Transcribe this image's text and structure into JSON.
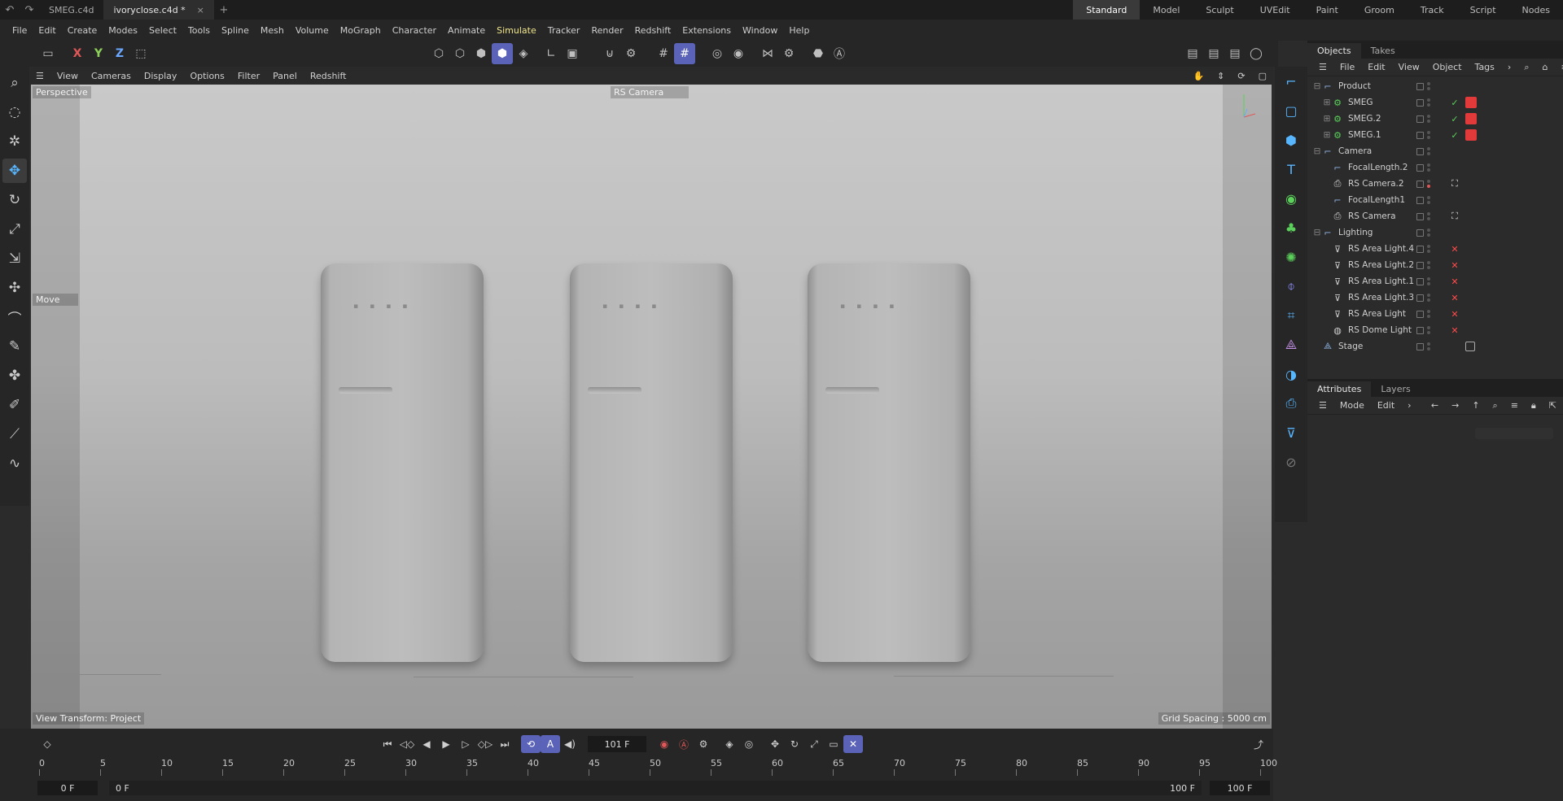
{
  "tabs": [
    {
      "label": "SMEG.c4d",
      "active": false
    },
    {
      "label": "ivoryclose.c4d *",
      "active": true
    }
  ],
  "layouts": [
    "Standard",
    "Model",
    "Sculpt",
    "UVEdit",
    "Paint",
    "Groom",
    "Track",
    "Script",
    "Nodes"
  ],
  "menu": [
    "File",
    "Edit",
    "Create",
    "Modes",
    "Select",
    "Tools",
    "Spline",
    "Mesh",
    "Volume",
    "MoGraph",
    "Character",
    "Animate",
    "Simulate",
    "Tracker",
    "Render",
    "Redshift",
    "Extensions",
    "Window",
    "Help"
  ],
  "toolbar": {
    "x": "X",
    "y": "Y",
    "z": "Z"
  },
  "viewport": {
    "menu": [
      "View",
      "Cameras",
      "Display",
      "Options",
      "Filter",
      "Panel",
      "Redshift"
    ],
    "mode_label": "Perspective",
    "camera_label": "RS Camera",
    "tool_label": "Move",
    "view_transform": "View Transform: Project",
    "grid_spacing": "Grid Spacing : 5000 cm"
  },
  "objects": {
    "tabs": [
      "Objects",
      "Takes"
    ],
    "menu": [
      "File",
      "Edit",
      "View",
      "Object",
      "Tags"
    ],
    "items": [
      {
        "label": "Product",
        "level": 0,
        "exp": "⊟",
        "icon": "null-icon",
        "color": "#8fb6e6"
      },
      {
        "label": "SMEG",
        "level": 1,
        "exp": "⊞",
        "icon": "object-icon",
        "color": "#5bd15b",
        "tag": "check",
        "tag2": "red"
      },
      {
        "label": "SMEG.2",
        "level": 1,
        "exp": "⊞",
        "icon": "object-icon",
        "color": "#5bd15b",
        "tag": "check",
        "tag2": "red"
      },
      {
        "label": "SMEG.1",
        "level": 1,
        "exp": "⊞",
        "icon": "object-icon",
        "color": "#5bd15b",
        "tag": "check",
        "tag2": "red"
      },
      {
        "label": "Camera",
        "level": 0,
        "exp": "⊟",
        "icon": "null-icon",
        "color": "#8fb6e6"
      },
      {
        "label": "FocalLength.2",
        "level": 1,
        "exp": "",
        "icon": "null-icon",
        "color": "#8fb6e6"
      },
      {
        "label": "RS Camera.2",
        "level": 1,
        "exp": "",
        "icon": "camera-icon",
        "color": "#cfcfcf",
        "reddot": true
      },
      {
        "label": "FocalLength1",
        "level": 1,
        "exp": "",
        "icon": "null-icon",
        "color": "#8fb6e6"
      },
      {
        "label": "RS Camera",
        "level": 1,
        "exp": "",
        "icon": "camera-icon",
        "color": "#cfcfcf"
      },
      {
        "label": "Lighting",
        "level": 0,
        "exp": "⊟",
        "icon": "null-icon",
        "color": "#8fb6e6"
      },
      {
        "label": "RS Area Light.4",
        "level": 1,
        "exp": "",
        "icon": "light-icon",
        "color": "#cfcfcf",
        "tag": "x"
      },
      {
        "label": "RS Area Light.2",
        "level": 1,
        "exp": "",
        "icon": "light-icon",
        "color": "#cfcfcf",
        "tag": "x"
      },
      {
        "label": "RS Area Light.1",
        "level": 1,
        "exp": "",
        "icon": "light-icon",
        "color": "#cfcfcf",
        "tag": "x"
      },
      {
        "label": "RS Area Light.3",
        "level": 1,
        "exp": "",
        "icon": "light-icon",
        "color": "#cfcfcf",
        "tag": "x"
      },
      {
        "label": "RS Area Light",
        "level": 1,
        "exp": "",
        "icon": "light-icon",
        "color": "#cfcfcf",
        "tag": "x"
      },
      {
        "label": "RS Dome Light",
        "level": 1,
        "exp": "",
        "icon": "dome-light-icon",
        "color": "#cfcfcf",
        "tag": "x"
      },
      {
        "label": "Stage",
        "level": 0,
        "exp": "",
        "icon": "stage-icon",
        "color": "#8fb6e6"
      }
    ]
  },
  "attributes": {
    "tabs": [
      "Attributes",
      "Layers"
    ],
    "menu": [
      "Mode",
      "Edit"
    ]
  },
  "timeline": {
    "current_frame": "101 F",
    "ruler": [
      "0",
      "5",
      "10",
      "15",
      "20",
      "25",
      "30",
      "35",
      "40",
      "45",
      "50",
      "55",
      "60",
      "65",
      "70",
      "75",
      "80",
      "85",
      "90",
      "95",
      "100"
    ],
    "start_a": "0 F",
    "start_b": "0 F",
    "end_a": "100 F",
    "end_b": "100 F"
  },
  "colors": {
    "accent": "#5a63b8",
    "icon_blue": "#58b6ff",
    "check": "#5bd15b",
    "x_red": "#ff4b4b"
  }
}
